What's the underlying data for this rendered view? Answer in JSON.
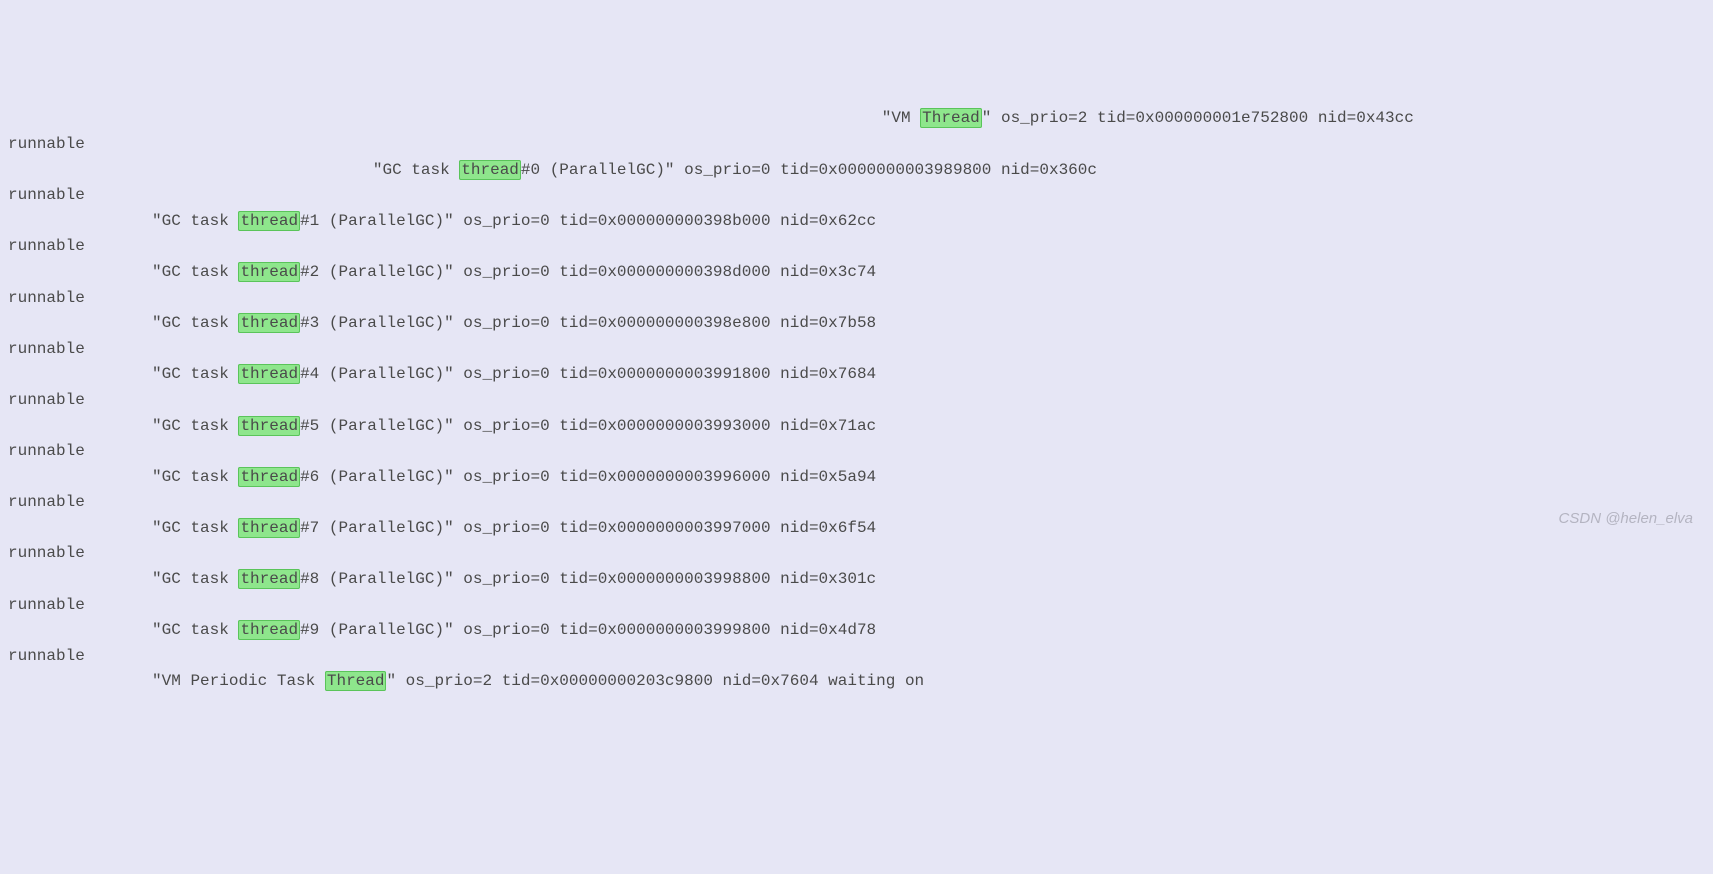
{
  "highlight": {
    "thread_lc": "thread",
    "thread_cap": "Thread"
  },
  "lines": [
    {
      "indent": "                                                                                           ",
      "pre": "\"VM ",
      "hl": "thread_cap",
      "post": "\" os_prio=2 tid=0x000000001e752800 nid=0x43cc"
    },
    {
      "indent": "",
      "pre": "runnable",
      "hl": null,
      "post": ""
    },
    {
      "indent": "                                      ",
      "pre": "\"GC task ",
      "hl": "thread_lc",
      "post": "#0 (ParallelGC)\" os_prio=0 tid=0x0000000003989800 nid=0x360c"
    },
    {
      "indent": "",
      "pre": "runnable",
      "hl": null,
      "post": ""
    },
    {
      "indent": "               ",
      "pre": "\"GC task ",
      "hl": "thread_lc",
      "post": "#1 (ParallelGC)\" os_prio=0 tid=0x000000000398b000 nid=0x62cc"
    },
    {
      "indent": "",
      "pre": "runnable",
      "hl": null,
      "post": ""
    },
    {
      "indent": "               ",
      "pre": "\"GC task ",
      "hl": "thread_lc",
      "post": "#2 (ParallelGC)\" os_prio=0 tid=0x000000000398d000 nid=0x3c74"
    },
    {
      "indent": "",
      "pre": "runnable",
      "hl": null,
      "post": ""
    },
    {
      "indent": "               ",
      "pre": "\"GC task ",
      "hl": "thread_lc",
      "post": "#3 (ParallelGC)\" os_prio=0 tid=0x000000000398e800 nid=0x7b58"
    },
    {
      "indent": "",
      "pre": "runnable",
      "hl": null,
      "post": ""
    },
    {
      "indent": "               ",
      "pre": "\"GC task ",
      "hl": "thread_lc",
      "post": "#4 (ParallelGC)\" os_prio=0 tid=0x0000000003991800 nid=0x7684"
    },
    {
      "indent": "",
      "pre": "runnable",
      "hl": null,
      "post": ""
    },
    {
      "indent": "               ",
      "pre": "\"GC task ",
      "hl": "thread_lc",
      "post": "#5 (ParallelGC)\" os_prio=0 tid=0x0000000003993000 nid=0x71ac"
    },
    {
      "indent": "",
      "pre": "runnable",
      "hl": null,
      "post": ""
    },
    {
      "indent": "               ",
      "pre": "\"GC task ",
      "hl": "thread_lc",
      "post": "#6 (ParallelGC)\" os_prio=0 tid=0x0000000003996000 nid=0x5a94"
    },
    {
      "indent": "",
      "pre": "runnable",
      "hl": null,
      "post": ""
    },
    {
      "indent": "               ",
      "pre": "\"GC task ",
      "hl": "thread_lc",
      "post": "#7 (ParallelGC)\" os_prio=0 tid=0x0000000003997000 nid=0x6f54"
    },
    {
      "indent": "",
      "pre": "runnable",
      "hl": null,
      "post": ""
    },
    {
      "indent": "               ",
      "pre": "\"GC task ",
      "hl": "thread_lc",
      "post": "#8 (ParallelGC)\" os_prio=0 tid=0x0000000003998800 nid=0x301c"
    },
    {
      "indent": "",
      "pre": "runnable",
      "hl": null,
      "post": ""
    },
    {
      "indent": "               ",
      "pre": "\"GC task ",
      "hl": "thread_lc",
      "post": "#9 (ParallelGC)\" os_prio=0 tid=0x0000000003999800 nid=0x4d78"
    },
    {
      "indent": "",
      "pre": "runnable",
      "hl": null,
      "post": ""
    },
    {
      "indent": "               ",
      "pre": "\"VM Periodic Task ",
      "hl": "thread_cap",
      "post": "\" os_prio=2 tid=0x00000000203c9800 nid=0x7604 waiting on"
    }
  ],
  "watermark": "CSDN @helen_elva"
}
